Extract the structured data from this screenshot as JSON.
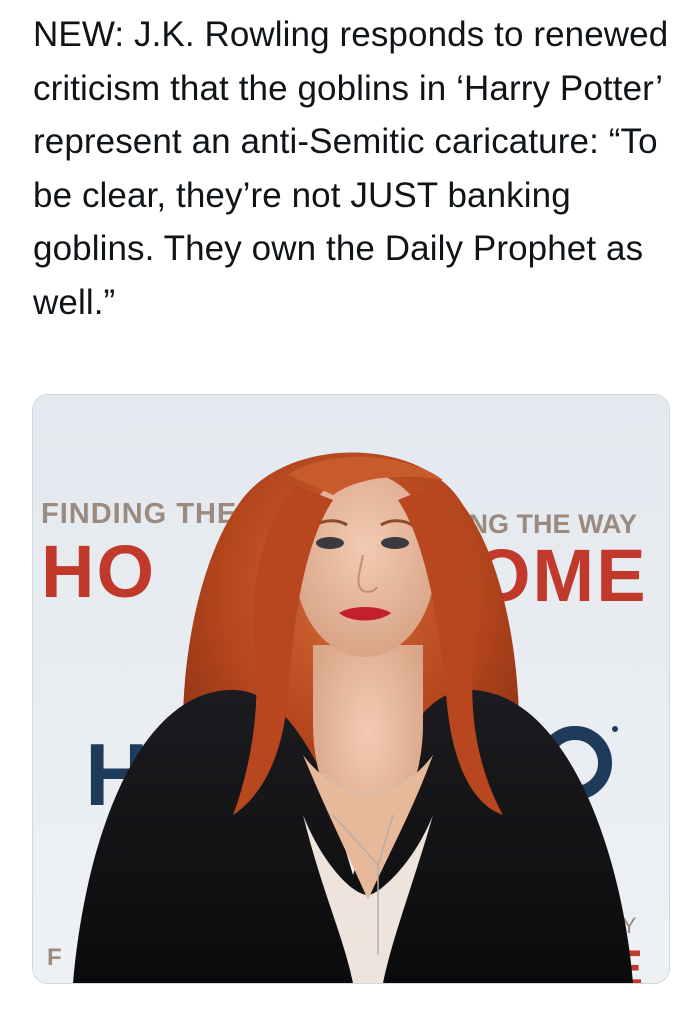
{
  "tweet": {
    "text": "NEW: J.K. Rowling responds to renewed criticism that the goblins in ‘Harry Potter’ represent an anti-Semitic caricature: “To be clear, they’re not JUST banking goblins. They own the Daily Prophet as well.”"
  },
  "media": {
    "backdrop": {
      "left_top": "FINDING THE",
      "left_big": "HO",
      "right_top": "ING THE WAY",
      "right_big": "OME",
      "right_bottom": "E WAY",
      "right_bottom_big": "ME",
      "left_bottom": "F",
      "logo_left": "H",
      "logo_right": "O"
    },
    "colors": {
      "banner_text": "#9a8a80",
      "banner_red": "#c0392b",
      "logo_blue": "#1f3b5c",
      "hair": "#b8461f",
      "jacket": "#121214"
    }
  }
}
